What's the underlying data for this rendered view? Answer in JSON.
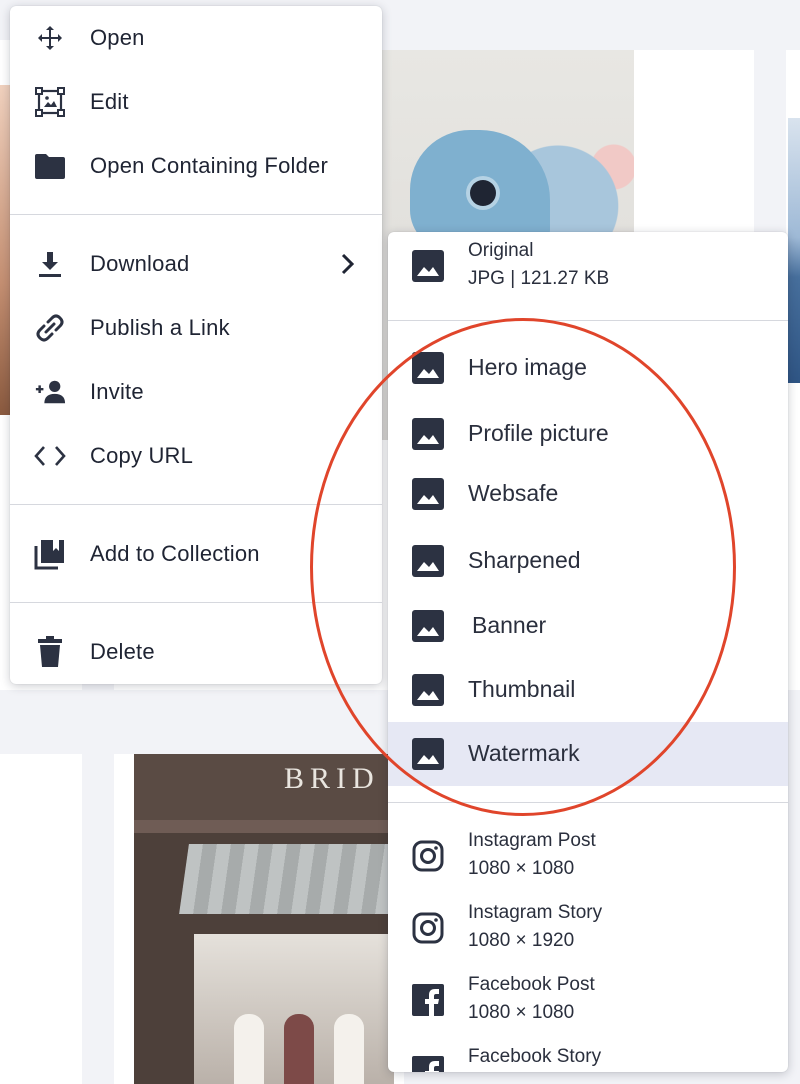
{
  "context_menu": {
    "items": [
      {
        "label": "Open",
        "icon": "move-arrows-icon"
      },
      {
        "label": "Edit",
        "icon": "edit-image-icon"
      },
      {
        "label": "Open Containing Folder",
        "icon": "folder-icon"
      },
      {
        "label": "Download",
        "icon": "download-icon"
      },
      {
        "label": "Publish a Link",
        "icon": "link-icon"
      },
      {
        "label": "Invite",
        "icon": "add-person-icon"
      },
      {
        "label": "Copy URL",
        "icon": "code-brackets-icon"
      },
      {
        "label": "Add to Collection",
        "icon": "collection-icon"
      },
      {
        "label": "Delete",
        "icon": "trash-icon"
      }
    ]
  },
  "download_submenu": {
    "original": {
      "label": "Original",
      "detail": "JPG | 121.27 KB"
    },
    "presets": [
      {
        "label": "Hero image"
      },
      {
        "label": "Profile picture"
      },
      {
        "label": "Websafe"
      },
      {
        "label": "Sharpened"
      },
      {
        "label": "Banner"
      },
      {
        "label": "Thumbnail"
      },
      {
        "label": "Watermark",
        "highlighted": true
      }
    ],
    "social": [
      {
        "label": "Instagram Post",
        "detail": "1080 × 1080",
        "icon": "instagram-icon"
      },
      {
        "label": "Instagram Story",
        "detail": "1080 × 1920",
        "icon": "instagram-icon"
      },
      {
        "label": "Facebook Post",
        "detail": "1080 × 1080",
        "icon": "facebook-icon"
      },
      {
        "label": "Facebook Story",
        "detail": "",
        "icon": "facebook-icon"
      }
    ]
  },
  "background": {
    "storefront_sign": "BRID"
  },
  "colors": {
    "menu_bg": "#ffffff",
    "highlight": "#e6e8f4",
    "annotation": "#e0452b",
    "icon": "#2c3242"
  }
}
